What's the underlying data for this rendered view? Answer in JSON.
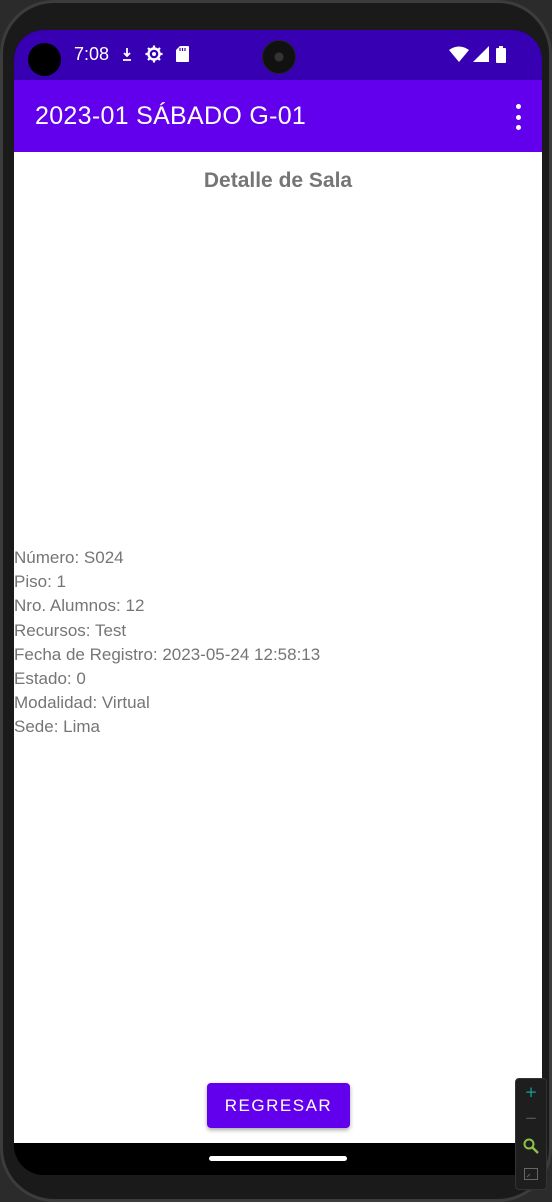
{
  "status_bar": {
    "time": "7:08"
  },
  "app_bar": {
    "title": "2023-01 SÁBADO G-01"
  },
  "main": {
    "title": "Detalle de Sala",
    "details": [
      "Número: S024",
      "Piso: 1",
      "Nro. Alumnos: 12",
      "Recursos: Test",
      "Fecha de Registro: 2023-05-24 12:58:13",
      "Estado: 0",
      "Modalidad: Virtual",
      "Sede: Lima"
    ],
    "back_button_label": "REGRESAR"
  },
  "colors": {
    "status_bar": "#3700b3",
    "primary": "#6200ee",
    "detail_text": "#757575"
  }
}
